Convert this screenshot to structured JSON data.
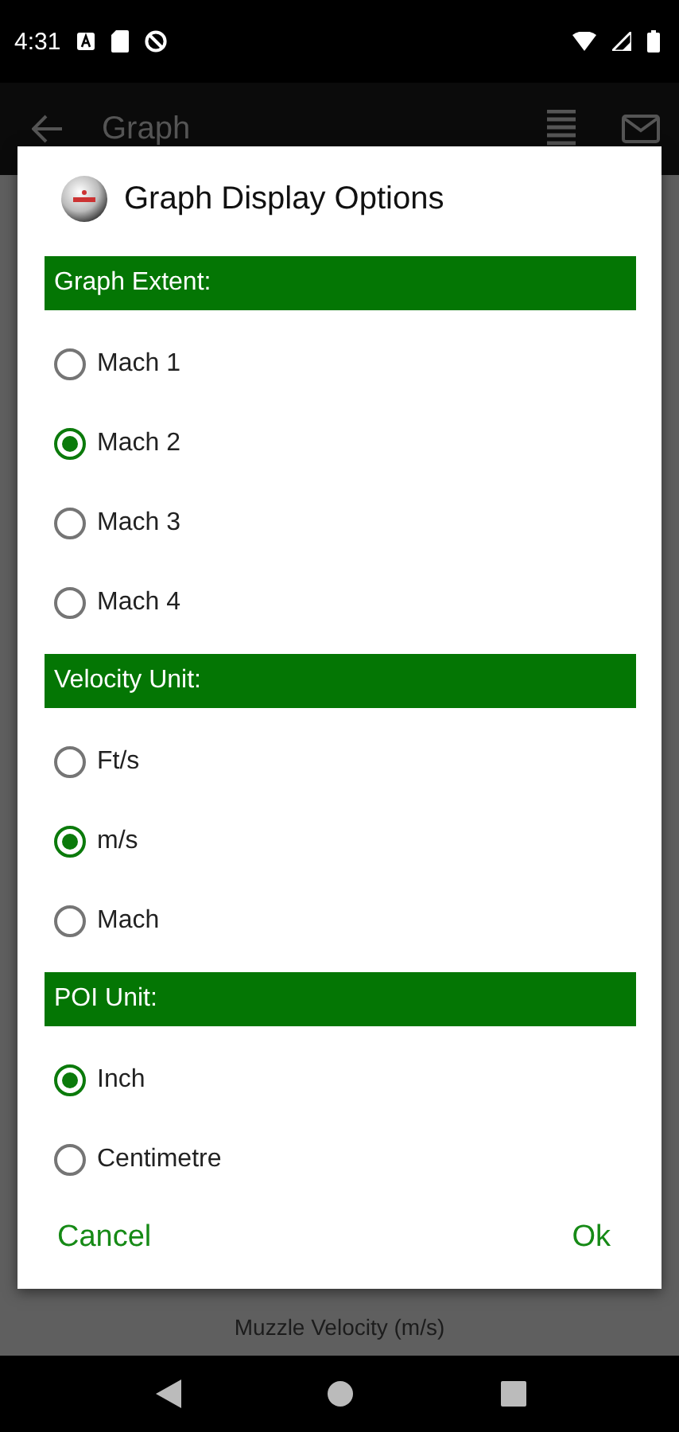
{
  "status_bar": {
    "time": "4:31"
  },
  "app_bar": {
    "title": "Graph"
  },
  "background": {
    "x_axis_label": "Muzzle Velocity (m/s)"
  },
  "dialog": {
    "title": "Graph Display Options",
    "sections": [
      {
        "heading": "Graph Extent:",
        "options": [
          {
            "label": "Mach 1",
            "selected": false
          },
          {
            "label": "Mach 2",
            "selected": true
          },
          {
            "label": "Mach 3",
            "selected": false
          },
          {
            "label": "Mach 4",
            "selected": false
          }
        ]
      },
      {
        "heading": "Velocity Unit:",
        "options": [
          {
            "label": "Ft/s",
            "selected": false
          },
          {
            "label": "m/s",
            "selected": true
          },
          {
            "label": "Mach",
            "selected": false
          }
        ]
      },
      {
        "heading": "POI Unit:",
        "options": [
          {
            "label": "Inch",
            "selected": true
          },
          {
            "label": "Centimetre",
            "selected": false
          }
        ]
      }
    ],
    "buttons": [
      "Cancel",
      "Ok"
    ]
  }
}
